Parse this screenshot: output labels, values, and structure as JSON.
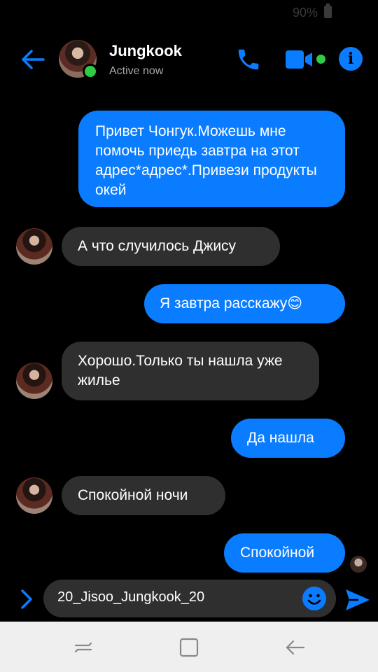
{
  "status_bar": {
    "battery": "90%"
  },
  "header": {
    "contact_name": "Jungkook",
    "contact_status": "Active now",
    "accent_color": "#0a7cff",
    "active_color": "#31cc46"
  },
  "messages": [
    {
      "side": "sent",
      "text": "Привет Чонгук.Можешь мне помочь приедь завтра на этот адрес*адрес*.Привези продукты окей"
    },
    {
      "side": "received",
      "text": "А что случилось Джису"
    },
    {
      "side": "sent",
      "text": "Я завтра расскажу😊"
    },
    {
      "side": "received",
      "text": "Хорошо.Только ты нашла уже жилье"
    },
    {
      "side": "sent",
      "text": "Да нашла"
    },
    {
      "side": "received",
      "text": "Спокойной ночи"
    },
    {
      "side": "sent",
      "text": "Спокойной"
    }
  ],
  "composer": {
    "value": "20_Jisoo_Jungkook_20"
  },
  "icons": {
    "back": "arrow-left-icon",
    "call": "phone-icon",
    "video": "video-camera-icon",
    "info": "info-icon",
    "expand": "chevron-right-icon",
    "emoji": "smiley-icon",
    "send": "send-icon",
    "nav_recent": "recent-apps-icon",
    "nav_home": "home-icon",
    "nav_back": "nav-back-icon"
  }
}
